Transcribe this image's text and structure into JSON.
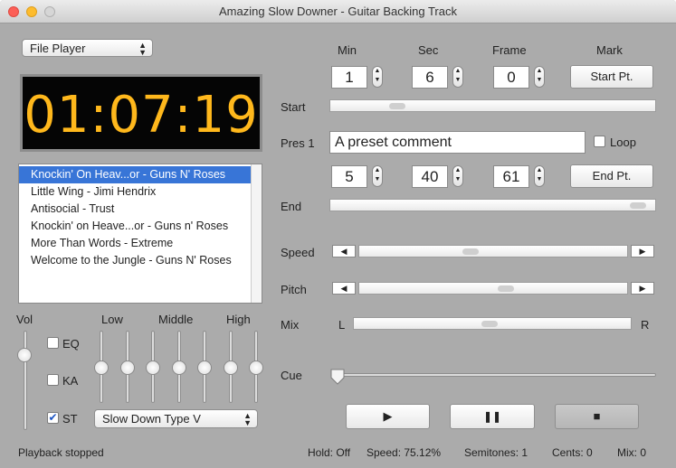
{
  "window": {
    "title": "Amazing Slow Downer - Guitar Backing Track"
  },
  "source_popup": {
    "value": "File Player"
  },
  "time_display": "01:07:19",
  "playlist": [
    "Knockin' On Heav...or - Guns N' Roses",
    "Little Wing  - Jimi Hendrix",
    "Antisocial - Trust",
    "Knockin' on Heave...or - Guns n' Roses",
    "More Than Words - Extreme",
    "Welcome to the Jungle - Guns N' Roses"
  ],
  "playlist_selected_index": 0,
  "headers": {
    "min": "Min",
    "sec": "Sec",
    "frame": "Frame",
    "mark": "Mark"
  },
  "start": {
    "label": "Start",
    "min": "1",
    "sec": "6",
    "frame": "0",
    "button": "Start Pt.",
    "position": 0.19
  },
  "preset": {
    "label": "Pres 1",
    "value": "A preset comment",
    "loop_label": "Loop",
    "loop_checked": false
  },
  "end": {
    "label": "End",
    "min": "5",
    "sec": "40",
    "frame": "61",
    "button": "End Pt.",
    "position": 0.97
  },
  "speed": {
    "label": "Speed",
    "position": 0.41
  },
  "pitch": {
    "label": "Pitch",
    "position": 0.55
  },
  "mix": {
    "label": "Mix",
    "left": "L",
    "right": "R",
    "position": 0.49
  },
  "cue": {
    "label": "Cue",
    "position": 0.0
  },
  "transport": {
    "play": "▶",
    "pause": "❚❚",
    "stop": "■"
  },
  "vol": {
    "label": "Vol",
    "level": 0.8
  },
  "options": {
    "eq": {
      "label": "EQ",
      "checked": false
    },
    "ka": {
      "label": "KA",
      "checked": false
    },
    "st": {
      "label": "ST",
      "checked": true
    }
  },
  "eq_bands": {
    "low": "Low",
    "middle": "Middle",
    "high": "High",
    "levels": [
      0.5,
      0.5,
      0.5,
      0.5,
      0.5,
      0.5,
      0.5
    ]
  },
  "slowdown_popup": {
    "value": "Slow Down Type V"
  },
  "status": {
    "left": "Playback stopped",
    "hold": "Hold: Off",
    "speed": "Speed: 75.12%",
    "semitones": "Semitones: 1",
    "cents": "Cents: 0",
    "mix": "Mix: 0"
  }
}
